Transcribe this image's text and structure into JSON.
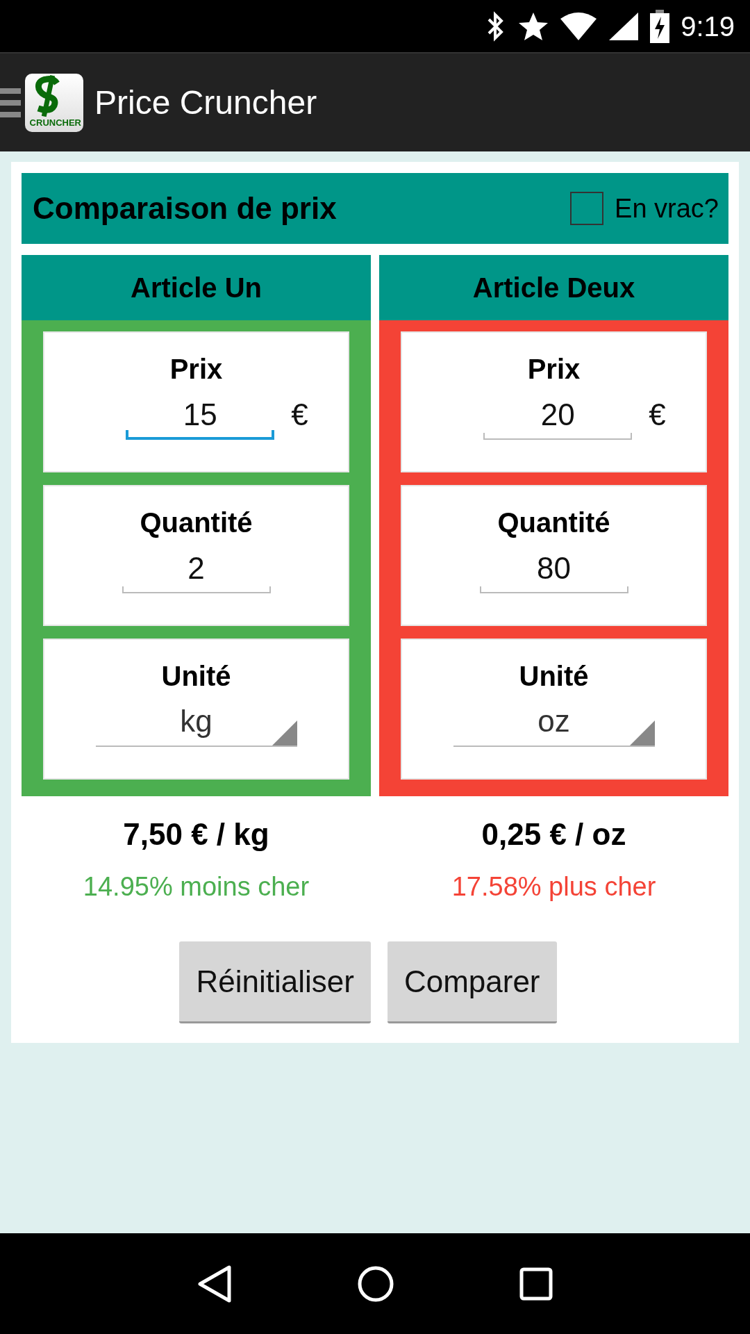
{
  "status_bar": {
    "time": "9:19"
  },
  "app_bar": {
    "title": "Price Cruncher",
    "logo_text": "CRUNCHER"
  },
  "header": {
    "title": "Comparaison de prix",
    "bulk_checkbox": {
      "label": "En vrac?",
      "checked": false
    }
  },
  "articles": [
    {
      "title": "Article Un",
      "color": "#4caf50",
      "price": {
        "label": "Prix",
        "value": "15",
        "currency": "€",
        "focused": true
      },
      "quantity": {
        "label": "Quantité",
        "value": "2"
      },
      "unit": {
        "label": "Unité",
        "value": "kg"
      },
      "unit_price": "7,50 € / kg",
      "difference": "14.95% moins cher"
    },
    {
      "title": "Article Deux",
      "color": "#f44336",
      "price": {
        "label": "Prix",
        "value": "20",
        "currency": "€",
        "focused": false
      },
      "quantity": {
        "label": "Quantité",
        "value": "80"
      },
      "unit": {
        "label": "Unité",
        "value": "oz"
      },
      "unit_price": "0,25 € / oz",
      "difference": "17.58% plus cher"
    }
  ],
  "buttons": [
    "Réinitialiser",
    "Comparer"
  ]
}
